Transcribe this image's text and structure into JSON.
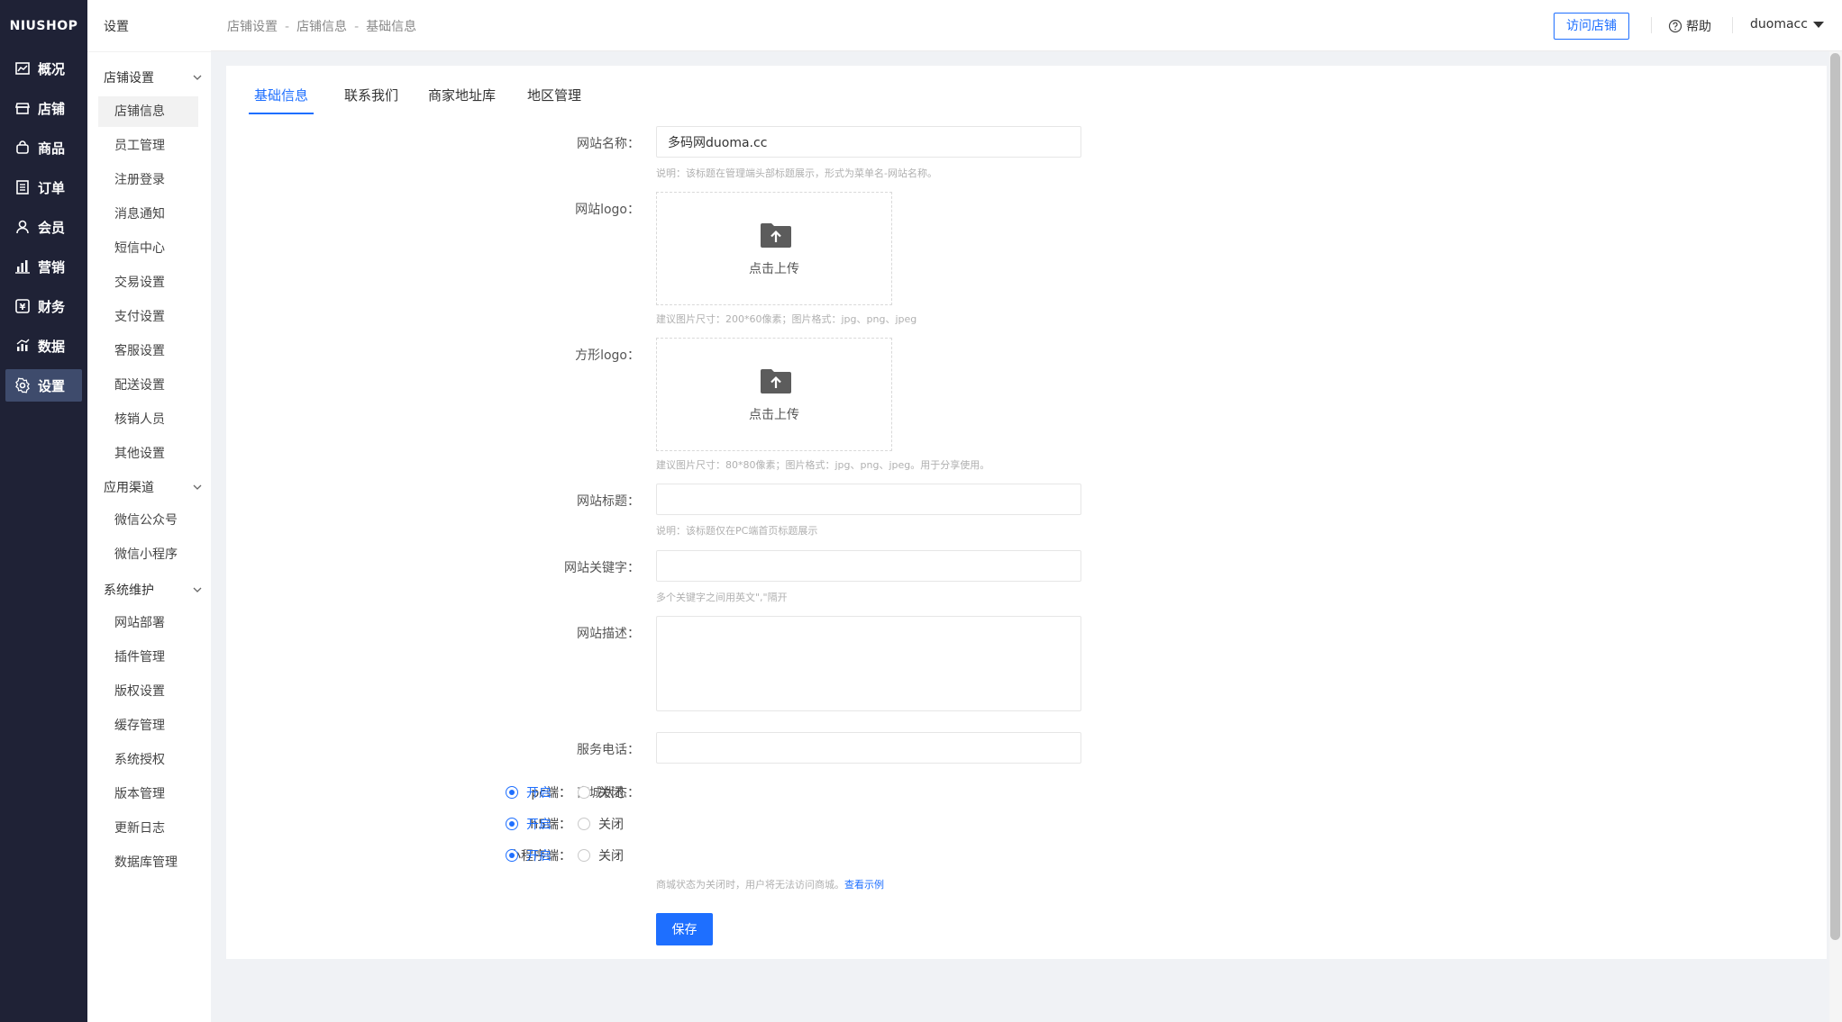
{
  "brand": {
    "logo": "NIUSHOP"
  },
  "nav": {
    "items": [
      {
        "label": "概况",
        "icon": "chart-icon"
      },
      {
        "label": "店铺",
        "icon": "store-icon"
      },
      {
        "label": "商品",
        "icon": "bag-icon"
      },
      {
        "label": "订单",
        "icon": "order-icon"
      },
      {
        "label": "会员",
        "icon": "user-icon"
      },
      {
        "label": "营销",
        "icon": "bar-icon"
      },
      {
        "label": "财务",
        "icon": "yen-icon"
      },
      {
        "label": "数据",
        "icon": "data-icon"
      },
      {
        "label": "设置",
        "icon": "gear-icon"
      }
    ],
    "active": "设置"
  },
  "submenu": {
    "title": "设置",
    "groups": {
      "shop": "店铺设置",
      "channel": "应用渠道",
      "system": "系统维护"
    },
    "shop_items": [
      "店铺信息",
      "员工管理",
      "注册登录",
      "消息通知",
      "短信中心",
      "交易设置",
      "支付设置",
      "客服设置",
      "配送设置",
      "核销人员",
      "其他设置"
    ],
    "channel_items": [
      "微信公众号",
      "微信小程序"
    ],
    "system_items": [
      "网站部署",
      "插件管理",
      "版权设置",
      "缓存管理",
      "系统授权",
      "版本管理",
      "更新日志",
      "数据库管理"
    ]
  },
  "topbar": {
    "breadcrumb": [
      "店铺设置",
      "店铺信息",
      "基础信息"
    ],
    "separator": "-",
    "visit_store": "访问店铺",
    "help": "帮助",
    "username": "duomacc"
  },
  "tabs": [
    "基础信息",
    "联系我们",
    "商家地址库",
    "地区管理"
  ],
  "form": {
    "site_name_label": "网站名称：",
    "site_name_value": "多码网duoma.cc",
    "site_name_hint": "说明：该标题在管理端头部标题展示，形式为菜单名-网站名称。",
    "logo_label": "网站logo：",
    "logo_upload": "点击上传",
    "logo_hint": "建议图片尺寸：200*60像素；图片格式：jpg、png、jpeg",
    "square_logo_label": "方形logo：",
    "square_logo_upload": "点击上传",
    "square_logo_hint": "建议图片尺寸：80*80像素；图片格式：jpg、png、jpeg。用于分享使用。",
    "site_title_label": "网站标题：",
    "site_title_hint": "说明：该标题仅在PC端首页标题展示",
    "keywords_label": "网站关键字：",
    "keywords_hint": "多个关键字之间用英文\",\"隔开",
    "desc_label": "网站描述：",
    "phone_label": "服务电话：",
    "status_label": "商城状态：",
    "status_rows": [
      {
        "label": "pc端：",
        "on": "开启",
        "off": "关闭"
      },
      {
        "label": "h5端：",
        "on": "开启",
        "off": "关闭"
      },
      {
        "label": "小程序端：",
        "on": "开启",
        "off": "关闭"
      }
    ],
    "status_hint": "商城状态为关闭时，用户将无法访问商城。",
    "status_hint_link": "查看示例",
    "save": "保存"
  },
  "colors": {
    "primary": "#1e6fff",
    "nav_bg": "#1f2236",
    "nav_active": "#3e4b6c"
  }
}
